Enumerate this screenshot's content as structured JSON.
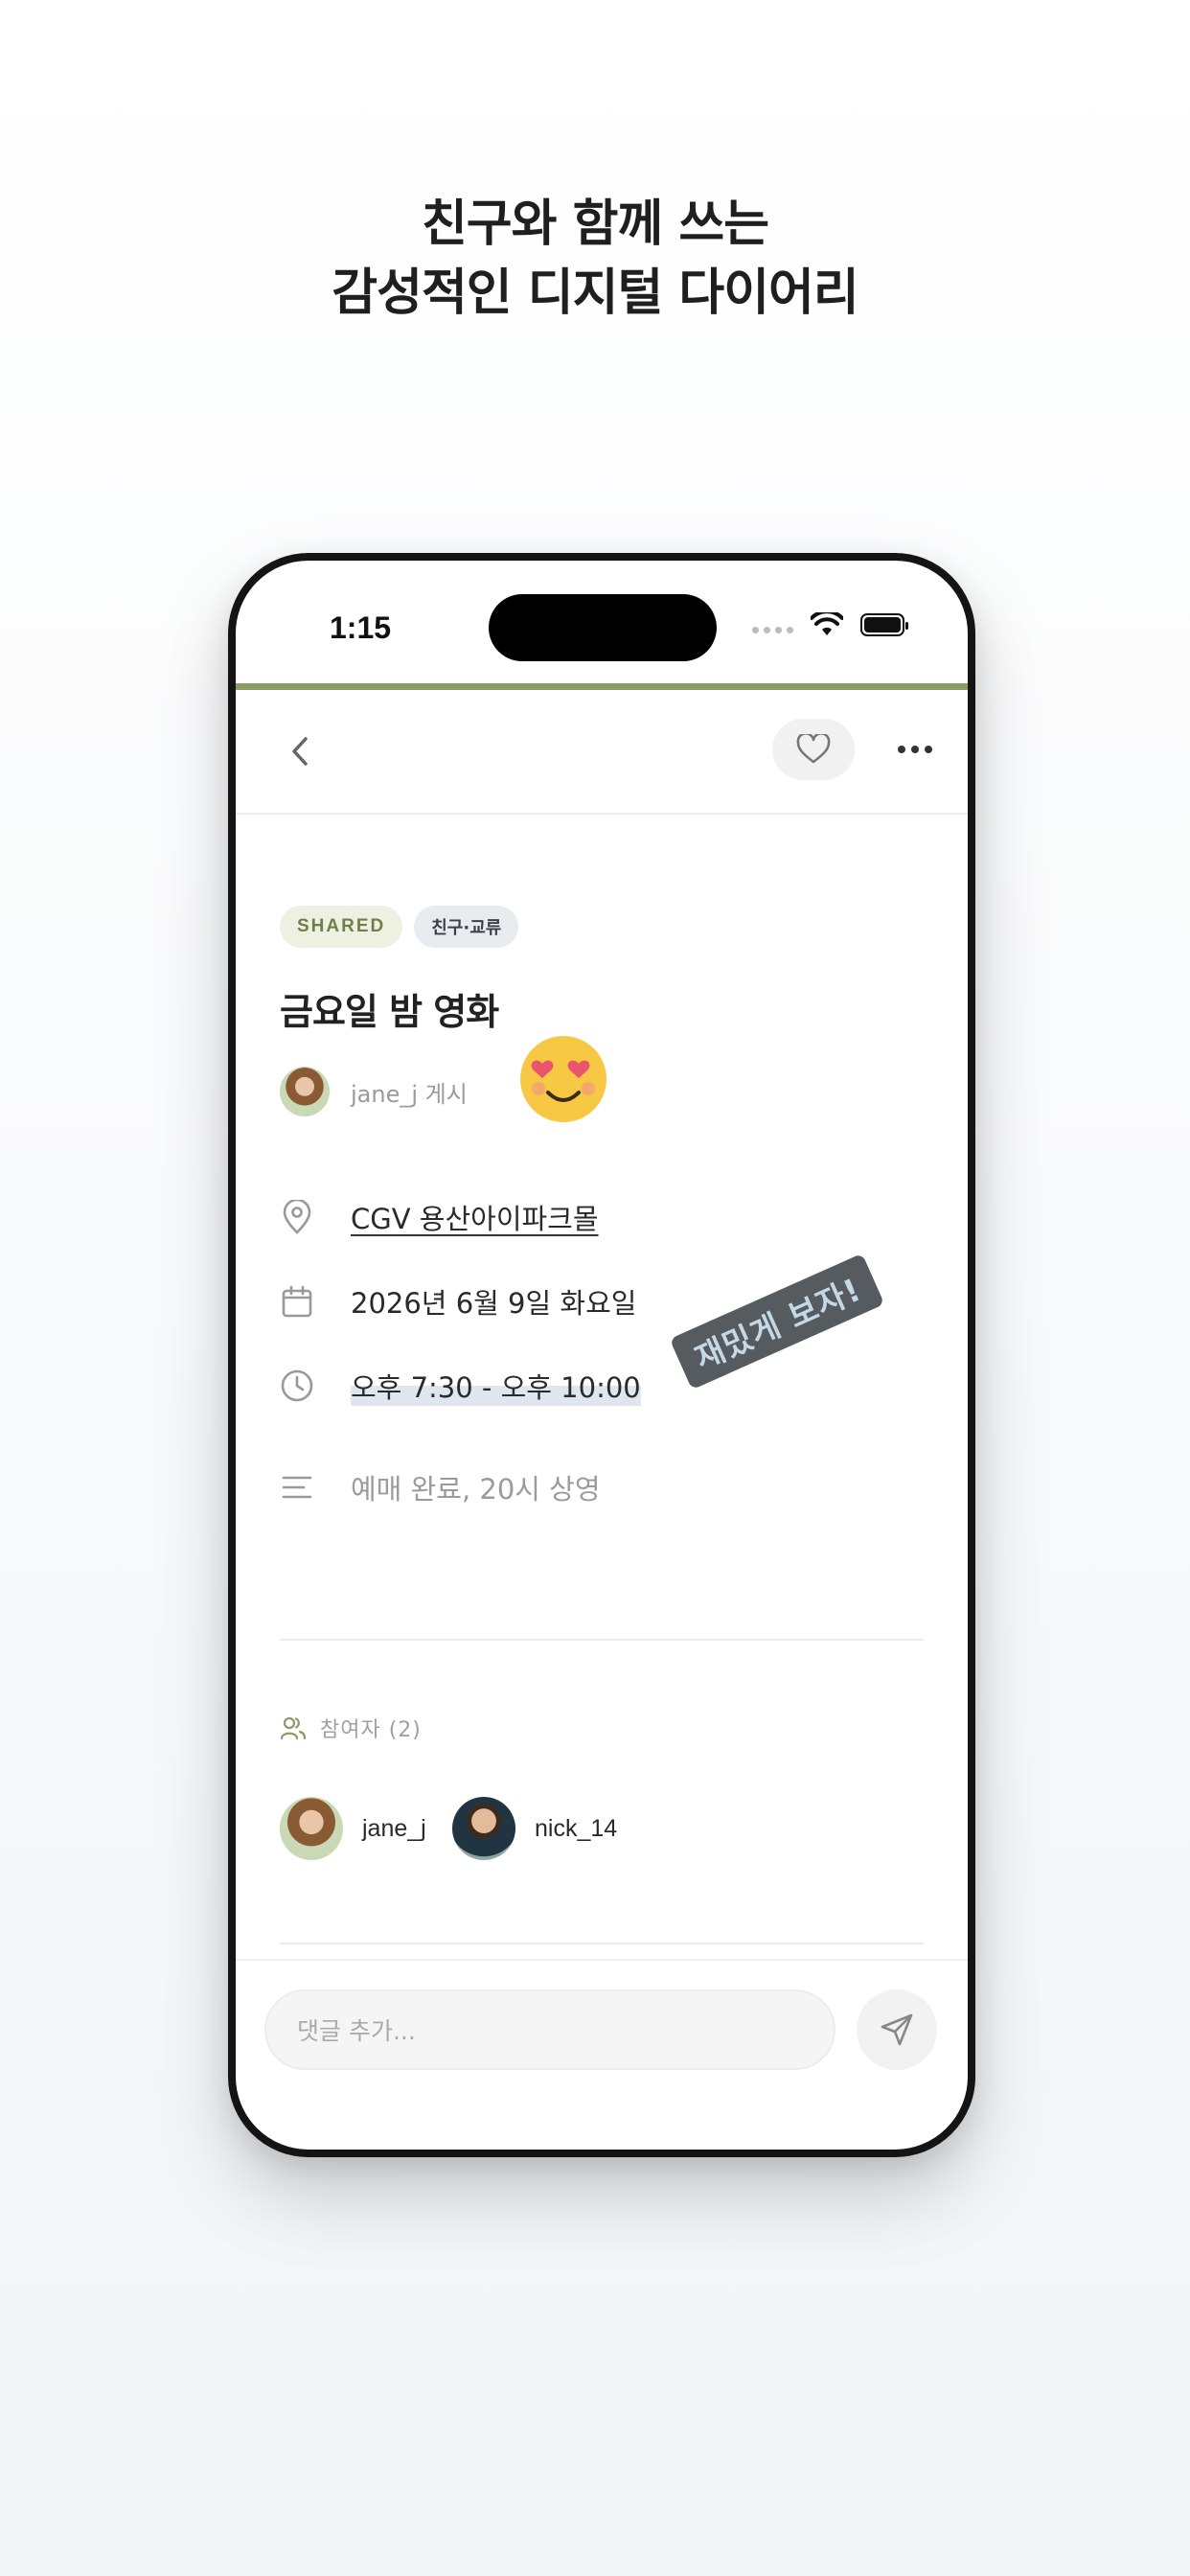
{
  "headline": {
    "line1": "친구와 함께 쓰는",
    "line2": "감성적인 디지털 다이어리"
  },
  "status_bar": {
    "time": "1:15"
  },
  "nav": {
    "back_icon": "chevron-left-icon",
    "heart_icon": "heart-icon",
    "more_icon": "ellipsis-icon"
  },
  "post": {
    "tags": [
      "SHARED",
      "친구·교류"
    ],
    "title": "금요일 밤 영화",
    "author": "jane_j 게시",
    "location": "CGV 용산아이파크몰",
    "date": "2026년 6월 9일 화요일",
    "time": "오후 7:30 - 오후 10:00",
    "note": "예매 완료, 20시 상영",
    "sticker_text": "재밌게 보자!",
    "emoji": "heart-eyes-emoji"
  },
  "participants": {
    "label": "참여자 (2)",
    "people": [
      {
        "name": "jane_j"
      },
      {
        "name": "nick_14"
      }
    ]
  },
  "comment": {
    "placeholder": "댓글 추가...",
    "send_icon": "send-icon"
  },
  "colors": {
    "accent": "#8b9d63",
    "shared_tag_bg": "#eef1e2",
    "category_tag_bg": "#e8ecf0",
    "sticker_bg": "#555b5f"
  }
}
